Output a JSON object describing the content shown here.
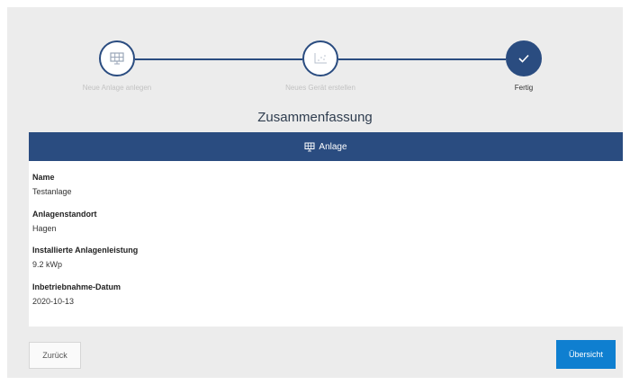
{
  "steps": [
    {
      "label": "Neue Anlage anlegen",
      "icon": "solar-panel-icon",
      "state": "done"
    },
    {
      "label": "Neues Gerät erstellen",
      "icon": "chart-icon",
      "state": "done"
    },
    {
      "label": "Fertig",
      "icon": "check-icon",
      "state": "active"
    }
  ],
  "summary": {
    "title": "Zusammenfassung",
    "section_label": "Anlage",
    "fields": [
      {
        "label": "Name",
        "value": "Testanlage"
      },
      {
        "label": "Anlagenstandort",
        "value": "Hagen"
      },
      {
        "label": "Installierte Anlagenleistung",
        "value": "9.2 kWp"
      },
      {
        "label": "Inbetriebnahme-Datum",
        "value": "2020-10-13"
      }
    ]
  },
  "buttons": {
    "back_label": "Zurück",
    "overview_label": "Übersicht"
  },
  "colors": {
    "accent": "#2a4c80",
    "primary_button": "#0f7fd0"
  }
}
